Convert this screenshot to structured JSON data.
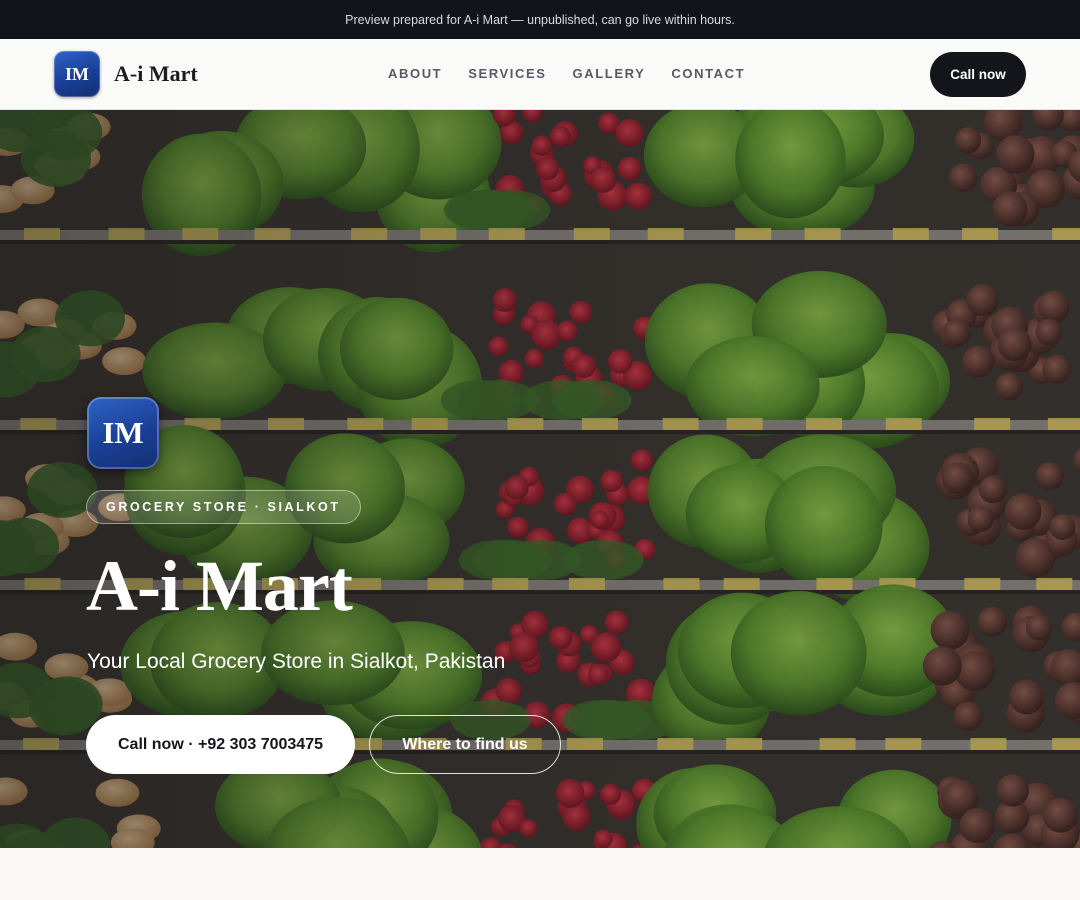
{
  "banner": {
    "text": "Preview prepared for A-i Mart — unpublished, can go live within hours."
  },
  "header": {
    "logo_initials": "IM",
    "brand_name": "A-i Mart",
    "nav": [
      "ABOUT",
      "SERVICES",
      "GALLERY",
      "CONTACT"
    ],
    "call_label": "Call now"
  },
  "hero": {
    "badge_initials": "IM",
    "tag": "GROCERY STORE · SIALKOT",
    "title": "A-i Mart",
    "subtitle": "Your Local Grocery Store in Sialkot, Pakistan",
    "call_button": "Call now · +92 303 7003475",
    "find_button": "Where to find us",
    "background_image": "grocery-produce-shelves"
  },
  "colors": {
    "brand_dark": "#13151b",
    "badge_blue": "#1a3f96",
    "banner_bg": "#11141a",
    "page_bg": "#faf9f6"
  }
}
